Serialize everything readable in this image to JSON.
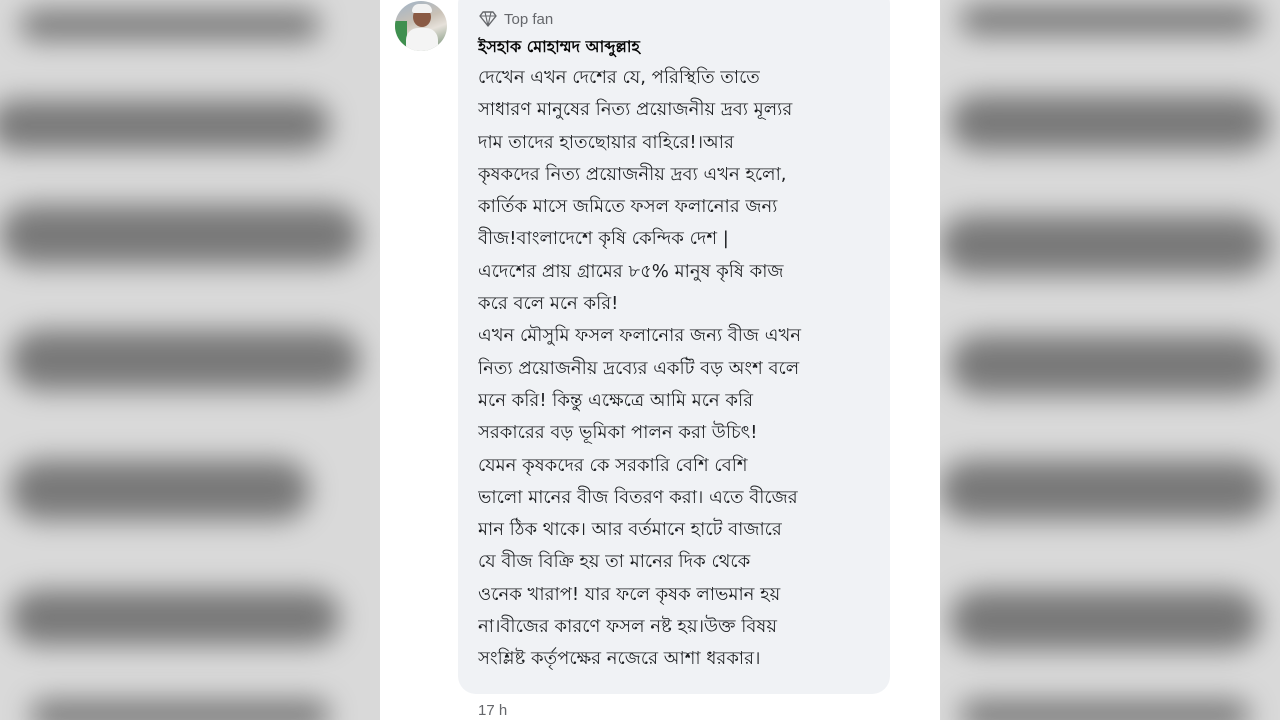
{
  "comment": {
    "badge_icon": "diamond-icon",
    "badge_label": "Top fan",
    "author_name": "ইসহাক মোহাম্মদ আব্দুল্লাহ",
    "lines": [
      "দেখেন এখন দেশের যে, পরিস্থিতি তাতে",
      "সাধারণ মানুষের নিত্য প্রয়োজনীয় দ্রব্য মূল্যর",
      "দাম তাদের হাতছোয়ার বাহিরে!।আর",
      "কৃষকদের নিত্য প্রয়োজনীয় দ্রব্য এখন হলো,",
      "কার্তিক মাসে জমিতে ফসল ফলানোর জন্য",
      "বীজ!বাংলাদেশে কৃষি কেন্দিক দেশ |",
      "এদেশের প্রায় গ্রামের ৮৫% মানুষ কৃষি কাজ",
      "করে বলে মনে করি!",
      "এখন মৌসুমি ফসল ফলানোর জন্য বীজ এখন",
      "নিত্য প্রয়োজনীয় দ্রব্যের একটি বড় অংশ বলে",
      "মনে করি! কিন্তু এক্ষেত্রে আমি মনে করি",
      "সরকারের বড় ভূমিকা পালন করা উচিৎ!",
      "যেমন কৃষকদের কে সরকারি বেশি বেশি",
      "ভালো মানের বীজ বিতরণ করা। এতে বীজের",
      "মান ঠিক থাকে। আর বর্তমানে হাটে বাজারে",
      "যে বীজ বিক্রি হয় তা মানের দিক থেকে",
      "ওনেক খারাপ! যার ফলে কৃষক লাভমান হয়",
      "না।বীজের কারণে ফসল নষ্ট হয়।উক্ত বিষয়",
      "সংশ্লিষ্ট কর্তৃপক্ষের নজেরে আশা ধরকার।"
    ],
    "timestamp": "17 h"
  },
  "colors": {
    "bubble": "#f0f2f5",
    "panel": "#ffffff",
    "secondary_text": "#65676b",
    "primary_text": "#050505",
    "blur_background": "#d9d9d9"
  }
}
